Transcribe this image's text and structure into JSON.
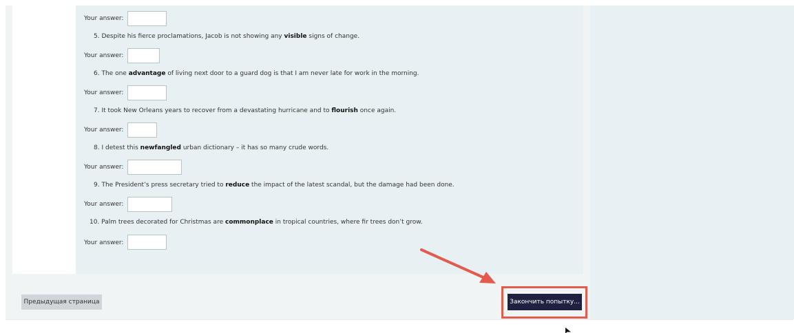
{
  "questions": [
    {
      "num": "",
      "text_pre": "",
      "bold": "",
      "text_post": ""
    },
    {
      "num": "5.",
      "text_pre": "Despite his fierce proclamations, Jacob is not showing any ",
      "bold": "visible",
      "text_post": " signs of change."
    },
    {
      "num": "6.",
      "text_pre": "The one ",
      "bold": "advantage",
      "text_post": " of living next door to a guard dog is that I am never late for work in the morning."
    },
    {
      "num": "7.",
      "text_pre": "It took New Orleans years to recover from a devastating hurricane and to ",
      "bold": "flourish",
      "text_post": " once again."
    },
    {
      "num": "8.",
      "text_pre": "I detest this ",
      "bold": "newfangled",
      "text_post": " urban dictionary – it has so many crude words."
    },
    {
      "num": "9.",
      "text_pre": "The President’s press secretary tried to ",
      "bold": "reduce",
      "text_post": " the impact of the latest scandal, but the damage had been done."
    },
    {
      "num": "10.",
      "text_pre": "Palm trees decorated for Christmas are ",
      "bold": "commonplace",
      "text_post": " in tropical countries, where fir trees don’t grow."
    }
  ],
  "answer_label": "Your answer:",
  "answers": [
    "",
    "",
    "",
    "",
    "",
    "",
    ""
  ],
  "nav": {
    "prev_label": "Предыдущая страница",
    "finish_label": "Закончить попытку..."
  },
  "colors": {
    "highlight": "#e35b4d",
    "finish_button": "#1f2140",
    "panel": "#e7f1f3"
  },
  "icons": {
    "annotation": "arrow-icon",
    "pointer": "cursor-icon"
  }
}
